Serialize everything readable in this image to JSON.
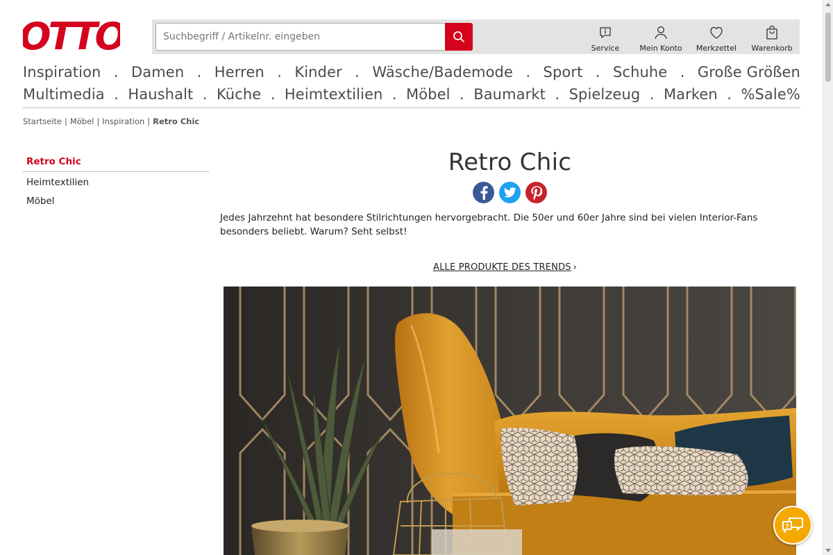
{
  "brand": {
    "logo_text": "OTTO",
    "color": "#d4021d"
  },
  "search": {
    "placeholder": "Suchbegriff / Artikelnr. eingeben",
    "value": ""
  },
  "header_tools": [
    {
      "label": "Service",
      "icon": "info-icon"
    },
    {
      "label": "Mein Konto",
      "icon": "user-icon"
    },
    {
      "label": "Merkzettel",
      "icon": "heart-icon"
    },
    {
      "label": "Warenkorb",
      "icon": "bag-icon"
    }
  ],
  "nav": {
    "row1": [
      "Inspiration",
      "Damen",
      "Herren",
      "Kinder",
      "Wäsche/Bademode",
      "Sport",
      "Schuhe",
      "Große Größen"
    ],
    "row2": [
      "Multimedia",
      "Haushalt",
      "Küche",
      "Heimtextilien",
      "Möbel",
      "Baumarkt",
      "Spielzeug",
      "Marken",
      "%Sale%"
    ],
    "separator": "."
  },
  "breadcrumb": {
    "items": [
      "Startseite",
      "Möbel",
      "Inspiration"
    ],
    "current": "Retro Chic",
    "separator": "|"
  },
  "sidebar": {
    "active": "Retro Chic",
    "items": [
      "Heimtextilien",
      "Möbel"
    ]
  },
  "main": {
    "title": "Retro Chic",
    "social": [
      "facebook-icon",
      "twitter-icon",
      "pinterest-icon"
    ],
    "intro": "Jedes Jahrzehnt hat besondere Stilrichtungen hervorgebracht. Die 50er und 60er Jahre sind bei vielen Interior-Fans besonders beliebt. Warum? Seht selbst!",
    "trend_link": "ALLE PRODUKTE DES TRENDS",
    "trend_chevron": "›"
  },
  "colors": {
    "accent": "#d4021d",
    "nav_text": "#4b4b4b",
    "header_bg": "#e3e3e3",
    "chat_button": "#f5a800",
    "facebook": "#3b5998",
    "twitter": "#1da1f2",
    "pinterest": "#c8232c"
  }
}
